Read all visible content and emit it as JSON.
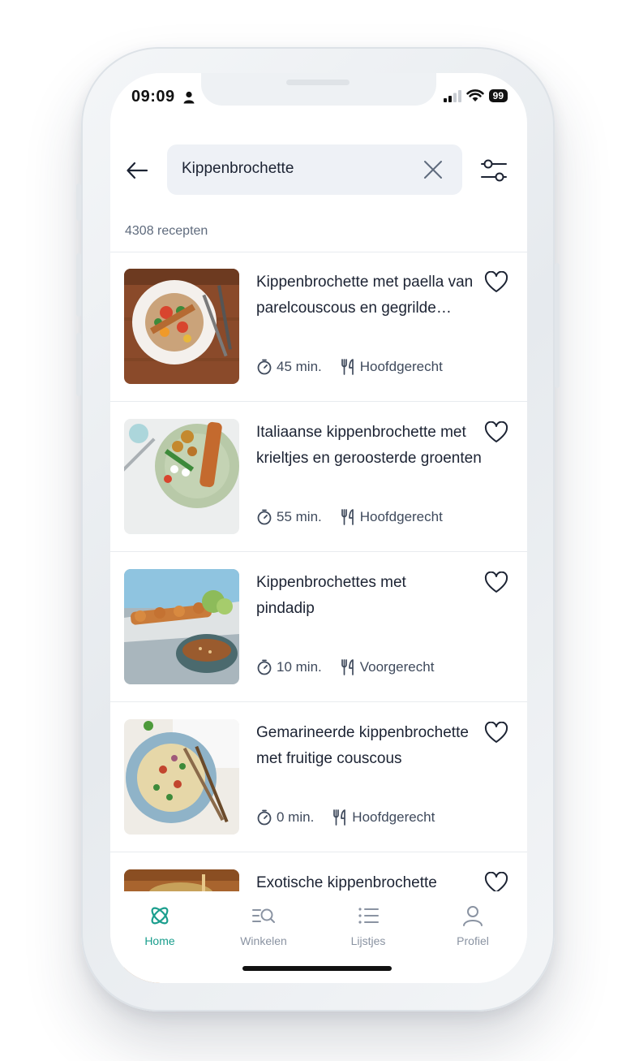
{
  "status_bar": {
    "time": "09:09",
    "battery": "99"
  },
  "search": {
    "query": "Kippenbrochette"
  },
  "results_count": "4308 recepten",
  "recipes": [
    {
      "title": "Kippenbrochette met paella van parelcouscous en gegrilde groenten",
      "time": "45 min.",
      "course": "Hoofdgerecht"
    },
    {
      "title": "Italiaanse kippenbrochette met krieltjes en geroosterde groenten",
      "time": "55 min.",
      "course": "Hoofdgerecht"
    },
    {
      "title": "Kippenbrochettes met pindadip",
      "time": "10 min.",
      "course": "Voorgerecht"
    },
    {
      "title": "Gemarineerde kippenbrochette met fruitige couscous",
      "time": "0 min.",
      "course": "Hoofdgerecht"
    },
    {
      "title": "Exotische kippenbrochette",
      "time": "",
      "course": ""
    }
  ],
  "tabs": [
    {
      "label": "Home",
      "icon": "atom-icon",
      "active": true
    },
    {
      "label": "Winkelen",
      "icon": "search-list-icon",
      "active": false
    },
    {
      "label": "Lijstjes",
      "icon": "list-icon",
      "active": false
    },
    {
      "label": "Profiel",
      "icon": "person-icon",
      "active": false
    }
  ],
  "colors": {
    "accent": "#1a9e8d",
    "text": "#1c2333",
    "muted": "#5f6b7d"
  }
}
